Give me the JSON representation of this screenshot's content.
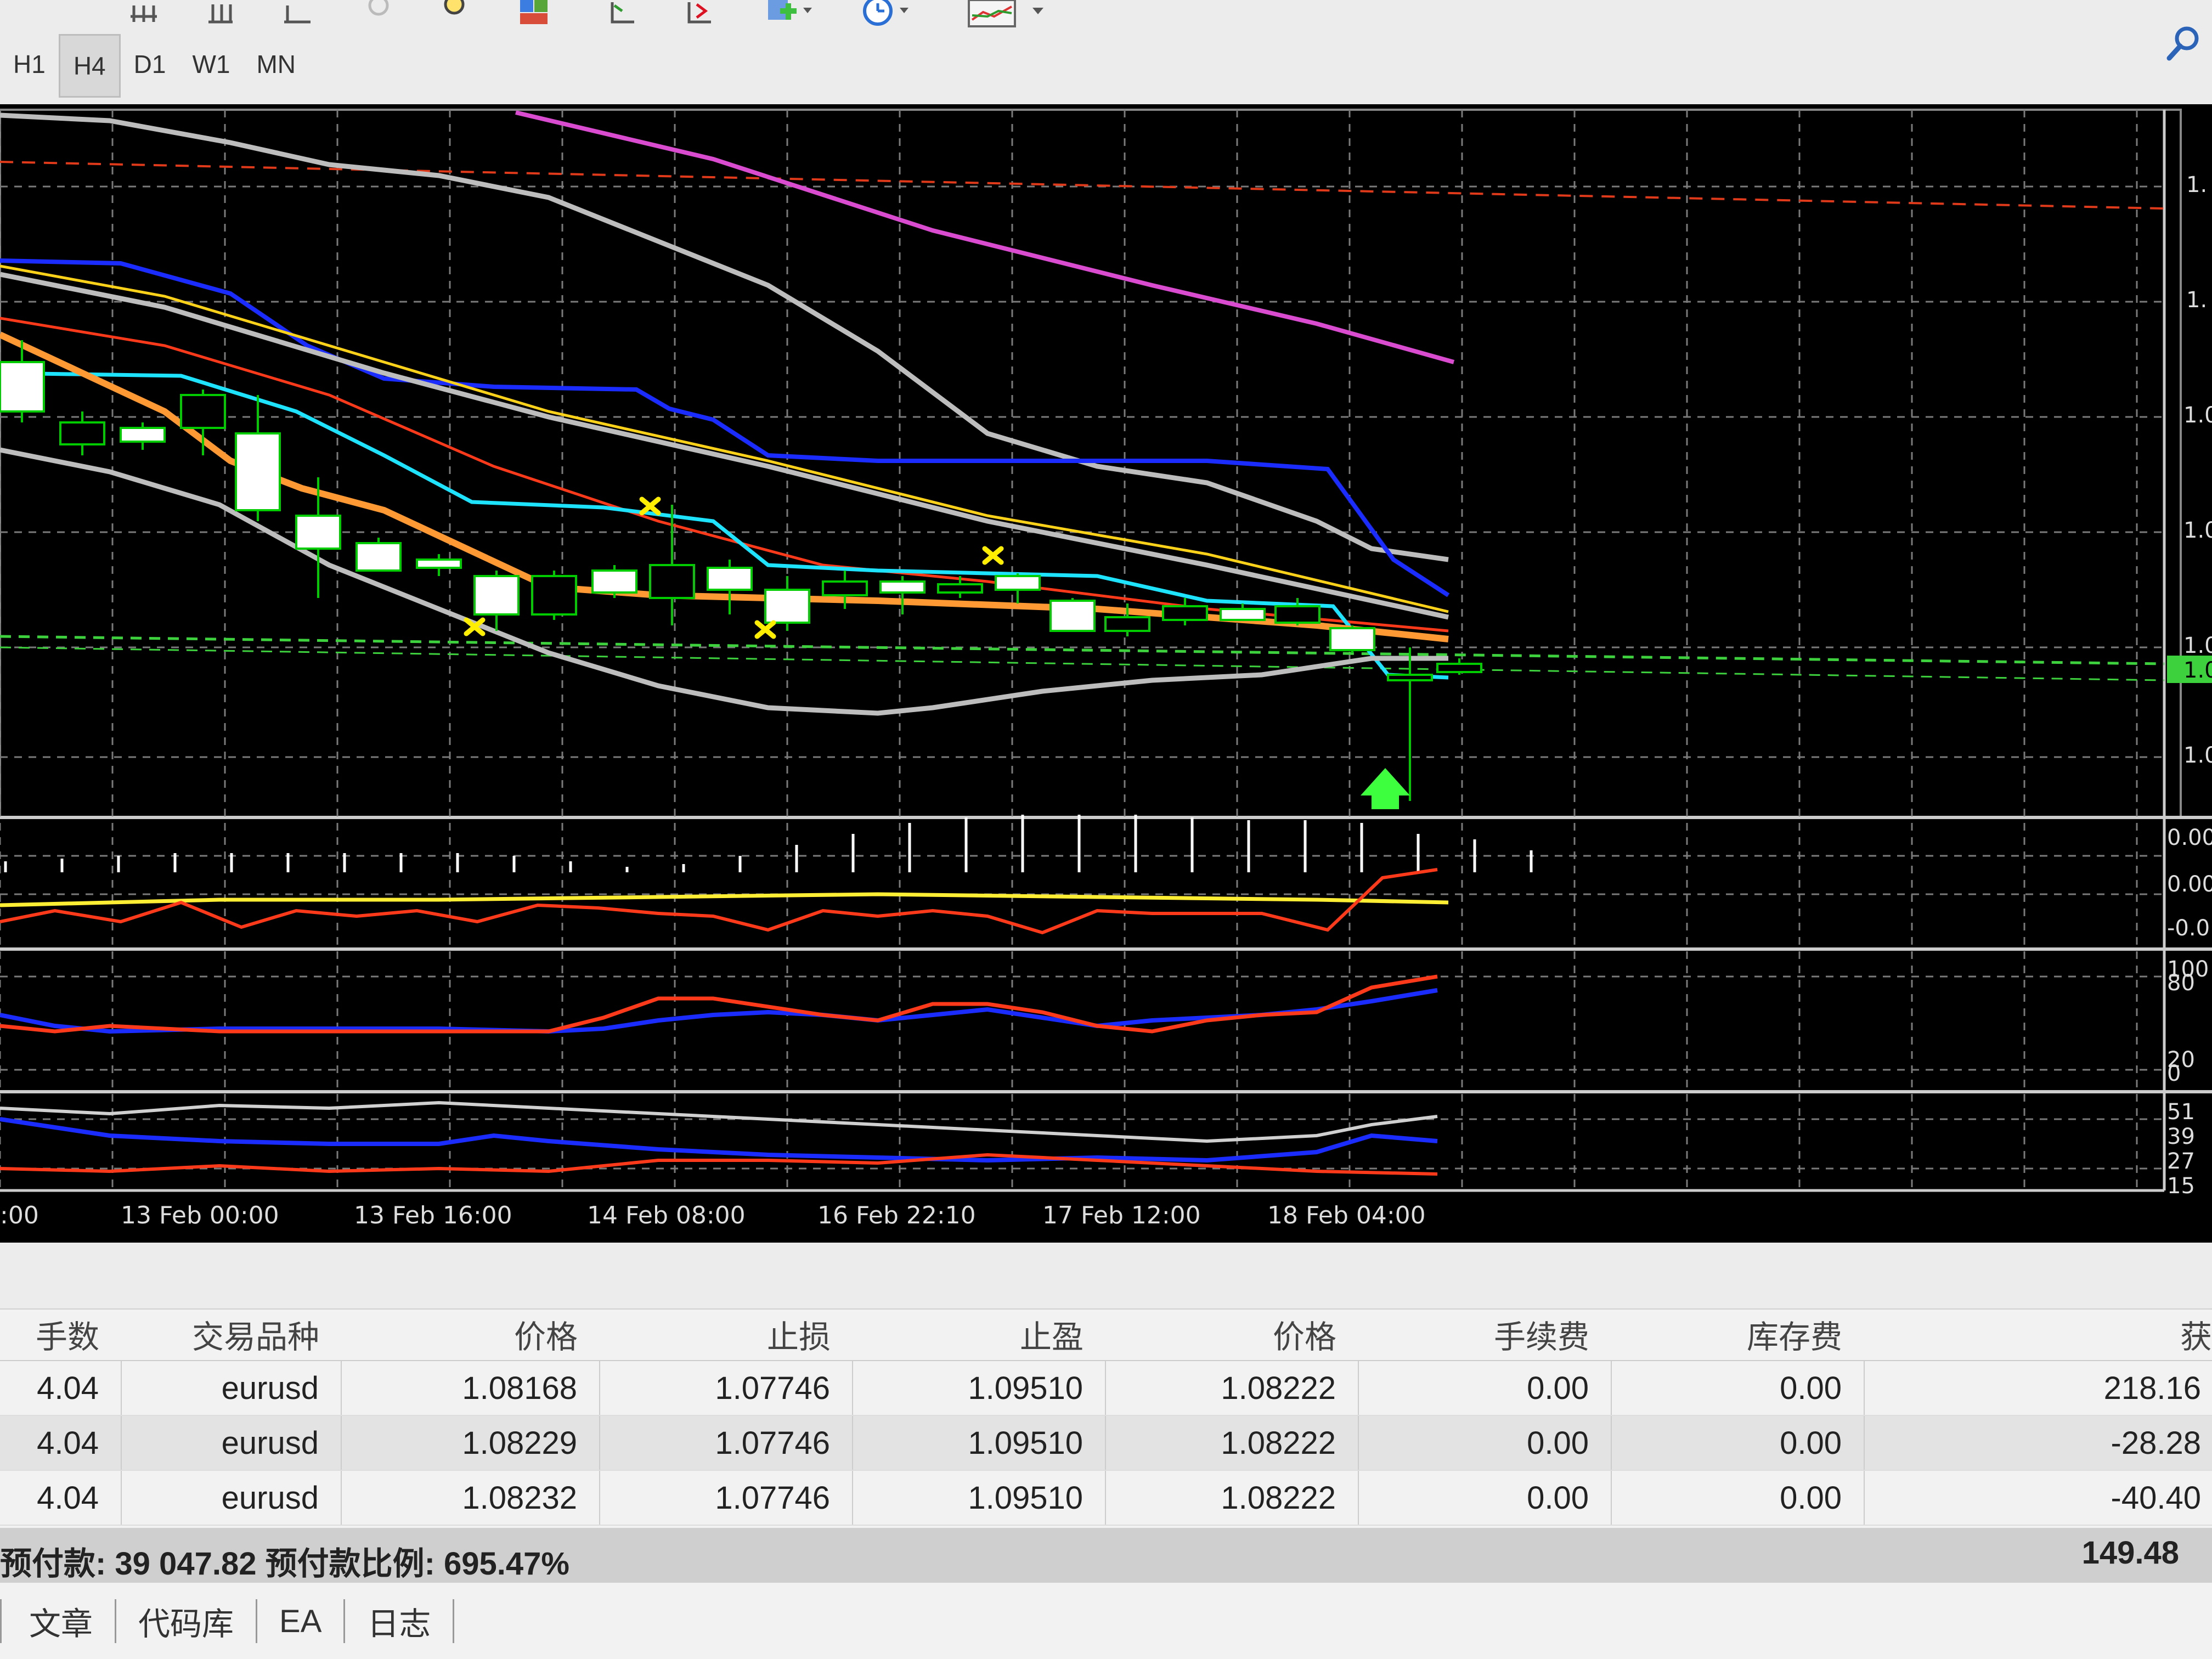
{
  "colors": {
    "background": "#000000",
    "grid": "#7a7a7a",
    "bull_candle": "#00cc00",
    "bear_candle": "#ffffff",
    "ma_orange": "#ff9933",
    "ma_blue": "#1a2cff",
    "ma_cyan": "#1ee3ff",
    "ma_red": "#ff3a1a",
    "ma_gray": "#bdbdbd",
    "ma_yellow": "#ffd21a",
    "ma_magenta": "#d94ccf",
    "fractal": "#ffee00",
    "buy_arrow": "#00ff00",
    "line_dashed_red": "#e03a1a",
    "line_dashed_green": "#3dd13d"
  },
  "toolbar": {
    "icons": [
      "grid-icon",
      "bar-icon",
      "line-icon",
      "zoom-out-icon",
      "zoom-in-icon",
      "tile-icon",
      "period-sep-icon",
      "period-shift-icon",
      "indicator-add-icon",
      "clock-icon",
      "template-icon"
    ],
    "timeframes": [
      "H1",
      "H4",
      "D1",
      "W1",
      "MN"
    ],
    "active_timeframe": "H4"
  },
  "chart": {
    "time_labels": [
      ":00",
      "13 Feb 00:00",
      "13 Feb 16:00",
      "14 Feb 08:00",
      "16 Feb 22:10",
      "17 Feb 12:00",
      "18 Feb 04:00"
    ],
    "price_labels_main": [
      "1.",
      "1.",
      "1.0",
      "1.0",
      "1.0",
      "1.0",
      "1.0"
    ],
    "price_labels_macd": [
      "0.00",
      "0.00",
      "-0.0"
    ],
    "price_labels_stoch": [
      "100",
      "80",
      "20",
      "0"
    ],
    "price_labels_adx": [
      "51",
      "39",
      "27",
      "15"
    ]
  },
  "terminal": {
    "headers": [
      "手数",
      "交易品种",
      "价格",
      "止损",
      "止盈",
      "价格",
      "手续费",
      "库存费",
      "获"
    ],
    "rows": [
      [
        "4.04",
        "eurusd",
        "1.08168",
        "1.07746",
        "1.09510",
        "1.08222",
        "0.00",
        "0.00",
        "218.16"
      ],
      [
        "4.04",
        "eurusd",
        "1.08229",
        "1.07746",
        "1.09510",
        "1.08222",
        "0.00",
        "0.00",
        "-28.28"
      ],
      [
        "4.04",
        "eurusd",
        "1.08232",
        "1.07746",
        "1.09510",
        "1.08222",
        "0.00",
        "0.00",
        "-40.40"
      ]
    ],
    "summary_left": "预付款: 39 047.82  预付款比例: 695.47%",
    "summary_right": "149.48",
    "tabs": [
      "文章",
      "代码库",
      "EA",
      "日志"
    ]
  }
}
